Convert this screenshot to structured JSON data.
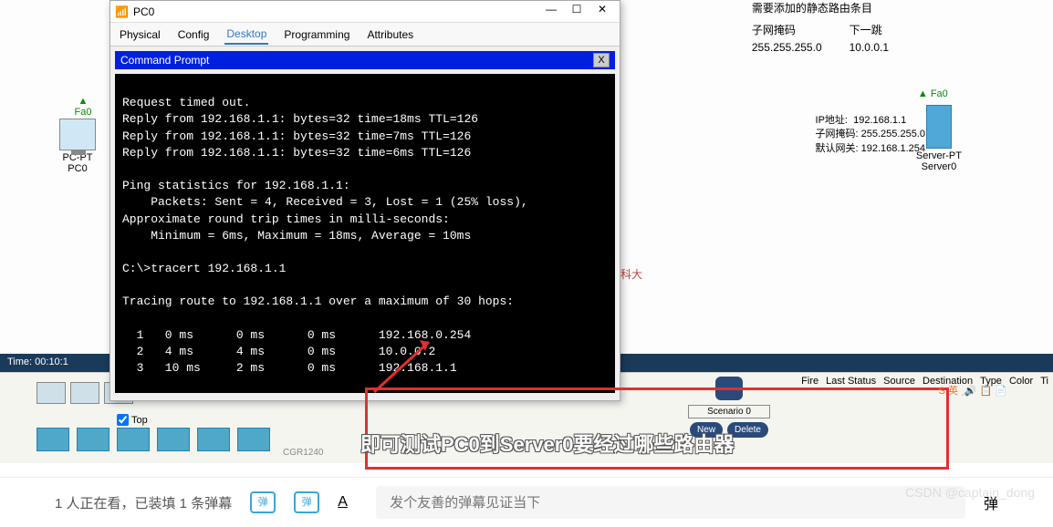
{
  "canvas": {
    "pc": {
      "name": "PC-PT",
      "id": "PC0",
      "interface": "Fa0"
    },
    "server": {
      "name": "Server-PT",
      "id": "Server0",
      "interface": "Fa0"
    },
    "ip_info": {
      "ip_label": "IP地址:",
      "ip": "192.168.1.1",
      "mask_label": "子网掩码:",
      "mask": "255.255.255.0",
      "gw_label": "默认网关:",
      "gw": "192.168.1.254"
    },
    "route_table": {
      "title": "需要添加的静态路由条目",
      "col1": "子网掩码",
      "col2": "下一跳",
      "mask": "255.255.255.0",
      "nexthop": "10.0.0.1"
    },
    "teacher": "湖科大\n教书匠"
  },
  "pc_window": {
    "title": "PC0",
    "tabs": [
      "Physical",
      "Config",
      "Desktop",
      "Programming",
      "Attributes"
    ],
    "active_tab": 2,
    "cmd_title": "Command Prompt",
    "terminal_lines": "\nRequest timed out.\nReply from 192.168.1.1: bytes=32 time=18ms TTL=126\nReply from 192.168.1.1: bytes=32 time=7ms TTL=126\nReply from 192.168.1.1: bytes=32 time=6ms TTL=126\n\nPing statistics for 192.168.1.1:\n    Packets: Sent = 4, Received = 3, Lost = 1 (25% loss),\nApproximate round trip times in milli-seconds:\n    Minimum = 6ms, Maximum = 18ms, Average = 10ms\n\nC:\\>tracert 192.168.1.1\n\nTracing route to 192.168.1.1 over a maximum of 30 hops:\n\n  1   0 ms      0 ms      0 ms      192.168.0.254\n  2   4 ms      4 ms      0 ms      10.0.0.2\n  3   10 ms     2 ms      0 ms      192.168.1.1\n\nTrace complete.\n\nC:\\>",
    "top_checkbox": "Top"
  },
  "time_bar": "Time: 00:10:1",
  "scenario": {
    "label": "Scenario 0",
    "new": "New",
    "delete": "Delete"
  },
  "sim_headers": [
    "Fire",
    "Last Status",
    "Source",
    "Destination",
    "Type",
    "Color",
    "Ti"
  ],
  "subtitle": "即可测试PC0到Server0要经过哪些路由器",
  "video": {
    "viewers": "1 人正在看，已装填 1 条弹幕",
    "danmu_short": "弹",
    "danmu_off": "弹",
    "input_placeholder": "发个友善的弹幕见证当下",
    "style_a": "A",
    "side": "弹"
  },
  "watermark": "CSDN @captain_dong",
  "ime": "S 英 ˏ🔊 📋 📄",
  "hidden_label": "CGR1240"
}
